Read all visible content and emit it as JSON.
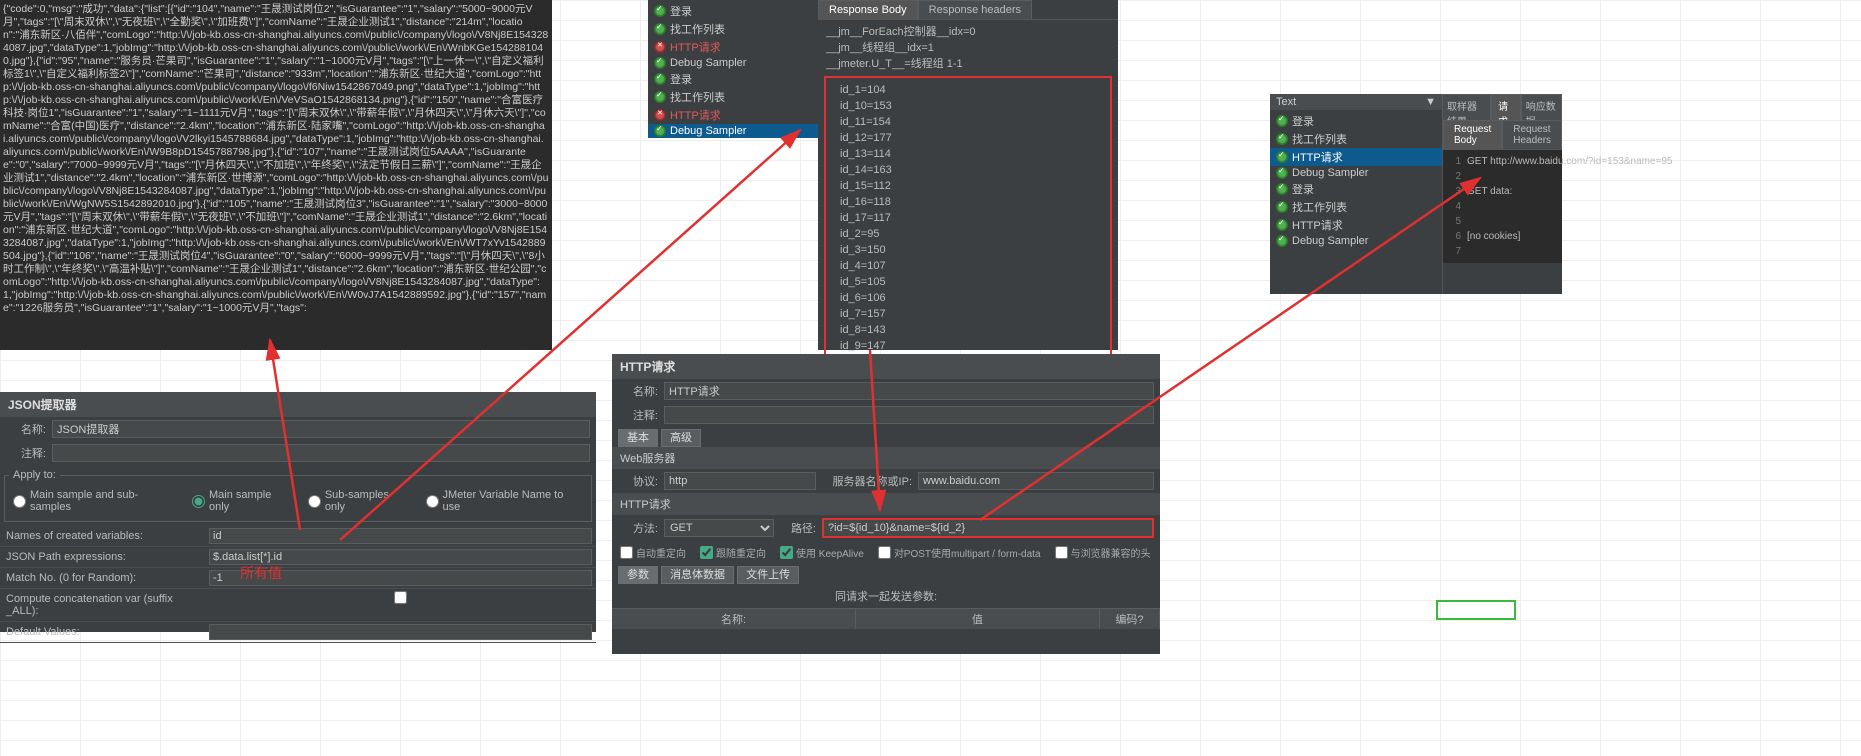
{
  "response_body_text": "{\"code\":0,\"msg\":\"成功\",\"data\":{\"list\":[{\"id\":\"104\",\"name\":\"王晟测试岗位2\",\"isGuarantee\":\"1\",\"salary\":\"5000~9000元V月\",\"tags\":\"[\\\"周末双休\\\",\\\"无夜班\\\",\\\"全勤奖\\\",\\\"加班费\\\"]\",\"comName\":\"王晟企业测试1\",\"distance\":\"214m\",\"location\":\"浦东新区·八佰伴\",\"comLogo\":\"http:\\/\\/job-kb.oss-cn-shanghai.aliyuncs.com\\/public\\/company\\/logo\\/V8Nj8E1543284087.jpg\",\"dataType\":1,\"jobImg\":\"http:\\/\\/job-kb.oss-cn-shanghai.aliyuncs.com\\/public\\/work\\/En\\/WnbKGe1542881040.jpg\"},{\"id\":\"95\",\"name\":\"服务员·芒果司\",\"isGuarantee\":\"1\",\"salary\":\"1~1000元V月\",\"tags\":\"[\\\"上一休一\\\",\\\"自定义福利标签1\\\",\\\"自定义福利标签2\\\"]\",\"comName\":\"芒果司\",\"distance\":\"933m\",\"location\":\"浦东新区·世纪大道\",\"comLogo\":\"http:\\/\\/job-kb.oss-cn-shanghai.aliyuncs.com\\/public\\/company\\/logo\\/f6Niw1542867049.png\",\"dataType\":1,\"jobImg\":\"http:\\/\\/job-kb.oss-cn-shanghai.aliyuncs.com\\/public\\/work\\/En\\/VeVSaO1542868134.png\"},{\"id\":\"150\",\"name\":\"合富医疗科技·岗位1\",\"isGuarantee\":\"1\",\"salary\":\"1~1111元V月\",\"tags\":\"[\\\"周末双休\\\",\\\"带薪年假\\\",\\\"月休四天\\\",\\\"月休六天\\\"]\",\"comName\":\"合富(中国)医疗\",\"distance\":\"2.4km\",\"location\":\"浦东新区·陆家嘴\",\"comLogo\":\"http:\\/\\/job-kb.oss-cn-shanghai.aliyuncs.com\\/public\\/company\\/logo\\/V2lkyi1545788684.jpg\",\"dataType\":1,\"jobImg\":\"http:\\/\\/job-kb.oss-cn-shanghai.aliyuncs.com\\/public\\/work\\/En\\/W9B8pD1545788798.jpg\"},{\"id\":\"107\",\"name\":\"王晟测试岗位5AAAA\",\"isGuarantee\":\"0\",\"salary\":\"7000~9999元V月\",\"tags\":\"[\\\"月休四天\\\",\\\"不加班\\\",\\\"年终奖\\\",\\\"法定节假日三薪\\\"]\",\"comName\":\"王晟企业测试1\",\"distance\":\"2.4km\",\"location\":\"浦东新区·世博源\",\"comLogo\":\"http:\\/\\/job-kb.oss-cn-shanghai.aliyuncs.com\\/public\\/company\\/logo\\/V8Nj8E1543284087.jpg\",\"dataType\":1,\"jobImg\":\"http:\\/\\/job-kb.oss-cn-shanghai.aliyuncs.com\\/public\\/work\\/En\\/WgNW5S1542892010.jpg\"},{\"id\":\"105\",\"name\":\"王晟测试岗位3\",\"isGuarantee\":\"1\",\"salary\":\"3000~8000元V月\",\"tags\":\"[\\\"周末双休\\\",\\\"带薪年假\\\",\\\"无夜班\\\",\\\"不加班\\\"]\",\"comName\":\"王晟企业测试1\",\"distance\":\"2.6km\",\"location\":\"浦东新区·世纪大道\",\"comLogo\":\"http:\\/\\/job-kb.oss-cn-shanghai.aliyuncs.com\\/public\\/company\\/logo\\/V8Nj8E1543284087.jpg\",\"dataType\":1,\"jobImg\":\"http:\\/\\/job-kb.oss-cn-shanghai.aliyuncs.com\\/public\\/work\\/En\\/WT7xYv1542889504.jpg\"},{\"id\":\"106\",\"name\":\"王晟测试岗位4\",\"isGuarantee\":\"0\",\"salary\":\"6000~9999元V月\",\"tags\":\"[\\\"月休四天\\\",\\\"8小时工作制\\\",\\\"年终奖\\\",\\\"高温补贴\\\"]\",\"comName\":\"王晟企业测试1\",\"distance\":\"2.6km\",\"location\":\"浦东新区·世纪公园\",\"comLogo\":\"http:\\/\\/job-kb.oss-cn-shanghai.aliyuncs.com\\/public\\/company\\/logo\\/V8Nj8E1543284087.jpg\",\"dataType\":1,\"jobImg\":\"http:\\/\\/job-kb.oss-cn-shanghai.aliyuncs.com\\/public\\/work\\/En\\/W0vJ7A1542889592.jpg\"},{\"id\":\"157\",\"name\":\"1226服务员\",\"isGuarantee\":\"1\",\"salary\":\"1~1000元V月\",\"tags\":",
  "json_extractor": {
    "title": "JSON提取器",
    "name_lbl": "名称:",
    "name_val": "JSON提取器",
    "comment_lbl": "注释:",
    "apply_to": "Apply to:",
    "radio_main_sub": "Main sample and sub-samples",
    "radio_main": "Main sample only",
    "radio_sub": "Sub-samples only",
    "radio_jmeter": "JMeter Variable Name to use",
    "f_names": "Names of created variables:",
    "f_names_v": "id",
    "f_json": "JSON Path expressions:",
    "f_json_v": "$.data.list[*].id",
    "f_match": "Match No. (0 for Random):",
    "f_match_v": "-1",
    "f_concat": "Compute concatenation var (suffix _ALL):",
    "f_default": "Default Values:",
    "annot_all": "所有值"
  },
  "tree1": {
    "items": [
      {
        "ok": true,
        "label": "登录"
      },
      {
        "ok": true,
        "label": "找工作列表"
      },
      {
        "ok": false,
        "label": "HTTP请求"
      },
      {
        "ok": true,
        "label": "Debug Sampler"
      },
      {
        "ok": true,
        "label": "登录"
      },
      {
        "ok": true,
        "label": "找工作列表"
      },
      {
        "ok": false,
        "label": "HTTP请求"
      },
      {
        "ok": true,
        "label": "Debug Sampler",
        "sel": true
      }
    ]
  },
  "resp_tabs": {
    "body": "Response Body",
    "headers": "Response headers"
  },
  "debug_vars": {
    "header": [
      "__jm__ForEach控制器__idx=0",
      "__jm__线程组__idx=1",
      "__jmeter.U_T__=线程组 1-1"
    ],
    "ids": [
      "id_1=104",
      "id_10=153",
      "id_11=154",
      "id_12=177",
      "id_13=114",
      "id_14=163",
      "id_15=112",
      "id_16=118",
      "id_17=117",
      "id_2=95",
      "id_3=150",
      "id_4=107",
      "id_5=105",
      "id_6=106",
      "id_7=157",
      "id_8=143",
      "id_9=147"
    ]
  },
  "http_req": {
    "title": "HTTP请求",
    "name_lbl": "名称:",
    "name_val": "HTTP请求",
    "comment_lbl": "注释:",
    "tab_basic": "基本",
    "tab_adv": "高级",
    "web_server": "Web服务器",
    "protocol_lbl": "协议:",
    "protocol_val": "http",
    "server_lbl": "服务器名称或IP:",
    "server_val": "www.baidu.com",
    "section": "HTTP请求",
    "method_lbl": "方法:",
    "method_val": "GET",
    "path_lbl": "路径:",
    "path_val": "?id=${id_10}&name=${id_2}",
    "chk_auto": "自动重定向",
    "chk_follow": "跟随重定向",
    "chk_keep": "使用 KeepAlive",
    "chk_multi": "对POST使用multipart / form-data",
    "chk_browser": "与浏览器兼容的头",
    "tab_params": "参数",
    "tab_body": "消息体数据",
    "tab_file": "文件上传",
    "send_with": "同请求一起发送参数:",
    "col_name": "名称:",
    "col_value": "值",
    "col_encode": "编码?"
  },
  "tree2": {
    "text_lbl": "Text",
    "items": [
      {
        "ok": true,
        "label": "登录"
      },
      {
        "ok": true,
        "label": "找工作列表"
      },
      {
        "ok": true,
        "label": "HTTP请求",
        "sel": true
      },
      {
        "ok": true,
        "label": "Debug Sampler"
      },
      {
        "ok": true,
        "label": "登录"
      },
      {
        "ok": true,
        "label": "找工作列表"
      },
      {
        "ok": true,
        "label": "HTTP请求"
      },
      {
        "ok": true,
        "label": "Debug Sampler"
      }
    ]
  },
  "result_tabs": {
    "sampler": "取样器结果",
    "request": "请求",
    "response": "响应数据"
  },
  "req_sub_tabs": {
    "body": "Request Body",
    "headers": "Request Headers"
  },
  "request_text": {
    "l1": "GET http://www.baidu.com/?id=153&name=95",
    "l3": "GET data:",
    "l6": "[no cookies]"
  }
}
